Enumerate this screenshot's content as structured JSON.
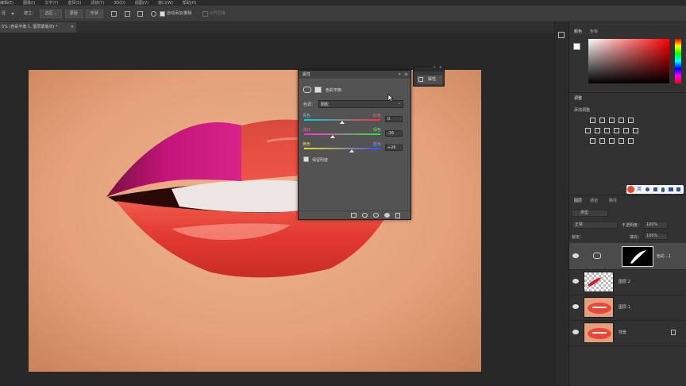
{
  "menubar": {
    "items": [
      "编辑(E)",
      "图像(I)",
      "文字(Y)",
      "选择(S)",
      "滤镜(T)",
      "3D(D)",
      "视图(V)",
      "窗口(W)",
      "帮助(H)"
    ]
  },
  "options": {
    "left_label": "径",
    "create_label": "建立：",
    "selection_btn": "选区...",
    "mask_btn": "蒙版",
    "shape_btn": "形状",
    "auto_add_delete": "自动添加/删除",
    "align_edges": "对齐边缘"
  },
  "document": {
    "tab_title": "5% (色彩平衡 1, 图层蒙版/8) *"
  },
  "properties": {
    "tab": "属性",
    "mini_label": "属性",
    "panel_name": "色彩平衡",
    "tone_label": "色调：",
    "tone_value": "阴影",
    "sliders": [
      {
        "left": "青色",
        "right": "红色",
        "value": "0",
        "level": 0
      },
      {
        "left": "洋红",
        "right": "绿色",
        "value": "-26",
        "level": -26
      },
      {
        "left": "黄色",
        "right": "蓝色",
        "value": "+26",
        "level": 26
      }
    ],
    "preserve_luminosity": "保留明度"
  },
  "color_panel": {
    "tab_active": "颜色",
    "tab_other": "色板"
  },
  "adjustments_panel": {
    "tab": "调整",
    "add_label": "添加调整"
  },
  "layers_panel": {
    "tabs": [
      "图层",
      "通道",
      "路径"
    ],
    "filter_label": "类型",
    "blend_mode": "正常",
    "opacity_label": "不透明度：",
    "opacity_value": "100%",
    "lock_label": "锁定：",
    "fill_label": "填充：",
    "fill_value": "100%",
    "layers": [
      {
        "name": "色彩...1"
      },
      {
        "name": "图层 2"
      },
      {
        "name": "图层 1"
      },
      {
        "name": "背景"
      }
    ]
  },
  "ime": {
    "label": "英"
  },
  "colors": {
    "accent": "#4a90d9",
    "ui_dark": "#323232",
    "lip_red": "#e8473a",
    "lip_magenta": "#c8197a"
  }
}
